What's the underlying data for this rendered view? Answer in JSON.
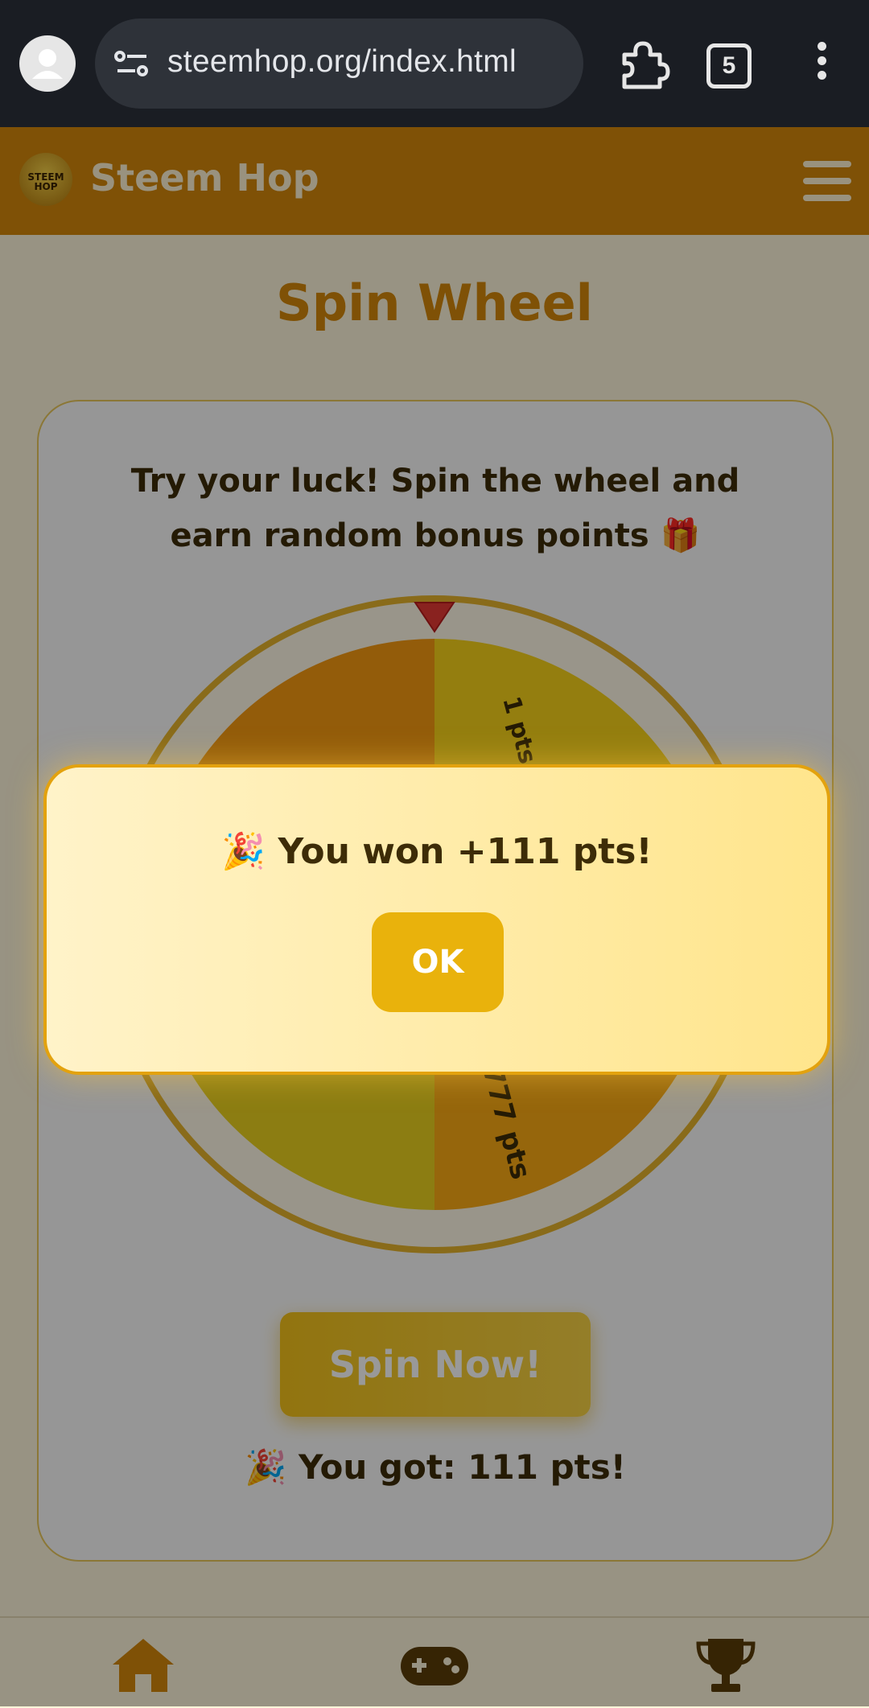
{
  "browser": {
    "url": "steemhop.org/index.html",
    "tab_count": "5",
    "icons": {
      "profile": "profile-icon",
      "site_settings": "tune-icon",
      "extensions": "puzzle-icon",
      "menu": "kebab-menu-icon"
    }
  },
  "app": {
    "brand": "Steem Hop",
    "logo_text": "STEEM HOP",
    "accent": "#d4870a"
  },
  "page": {
    "title": "Spin Wheel",
    "intro": "Try your luck! Spin the wheel and earn random bonus points 🎁",
    "spin_button": "Spin Now!",
    "result": "🎉 You got: 111 pts!"
  },
  "wheel": {
    "visible_labels": [
      "1 pts",
      "777 pts"
    ],
    "colors": [
      "#e9c514",
      "#ec8b10",
      "#f0b522",
      "#e9a41a",
      "#ddd11e",
      "#fbab14"
    ]
  },
  "modal": {
    "message": "🎉 You won +111 pts!",
    "ok_label": "OK"
  },
  "bottom_nav": {
    "items": [
      "home-icon",
      "gamepad-icon",
      "trophy-icon"
    ]
  }
}
